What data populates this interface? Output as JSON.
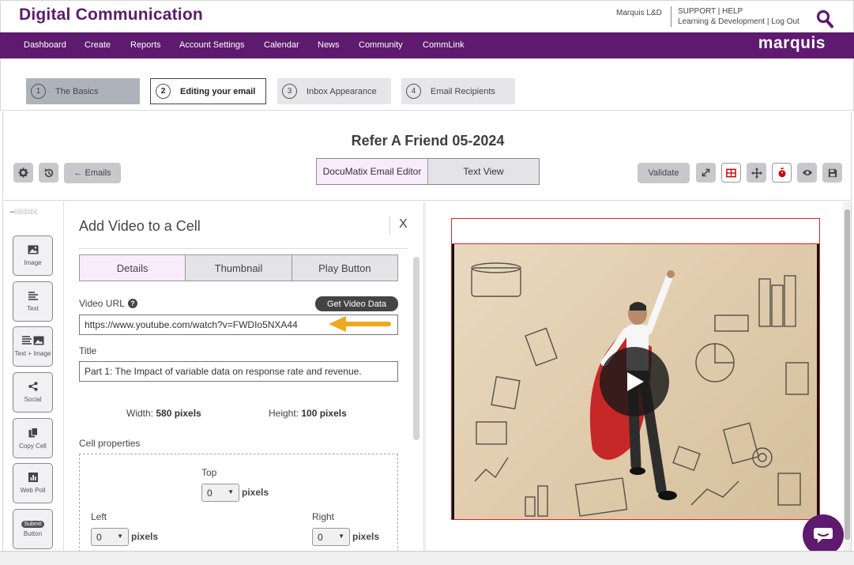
{
  "header": {
    "app_title": "Digital Communication",
    "user": "Marquis L&D",
    "support": "SUPPORT",
    "help": "HELP",
    "learning": "Learning & Development",
    "logout": "Log Out",
    "brand": "marquis"
  },
  "nav": {
    "items": [
      "Dashboard",
      "Create",
      "Reports",
      "Account Settings",
      "Calendar",
      "News",
      "Community",
      "CommLink"
    ]
  },
  "steps": [
    {
      "num": "1",
      "label": "The Basics"
    },
    {
      "num": "2",
      "label": "Editing your email"
    },
    {
      "num": "3",
      "label": "Inbox Appearance"
    },
    {
      "num": "4",
      "label": "Email Recipients"
    }
  ],
  "editor": {
    "email_title": "Refer A Friend 05-2024",
    "emails_button": "← Emails",
    "tab_editor": "DocuMatix Email Editor",
    "tab_text": "Text View",
    "validate": "Validate"
  },
  "rail": {
    "items": [
      "Image",
      "Text",
      "Text + Image",
      "Social",
      "Copy Cell",
      "Web Poll",
      "Button"
    ],
    "submit_pill": "Submit"
  },
  "panel": {
    "title": "Add Video to a Cell",
    "close": "X",
    "tabs": [
      "Details",
      "Thumbnail",
      "Play Button"
    ],
    "video_url_label": "Video URL",
    "help": "?",
    "get_video_data": "Get Video Data",
    "video_url": "https://www.youtube.com/watch?v=FWDIo5NXA44",
    "title_label": "Title",
    "title_value": "Part 1: The Impact of variable data on response rate and revenue.",
    "width_label": "Width:",
    "width_value": "580 pixels",
    "height_label": "Height:",
    "height_value": "100 pixels",
    "cell_props": "Cell properties",
    "top": "Top",
    "left": "Left",
    "right": "Right",
    "pad_value": "0",
    "pixels": "pixels"
  },
  "colors": {
    "brand_purple": "#5e1a6e",
    "active_tab": "#f9ebfb",
    "arrow": "#f0a820",
    "cell_border": "#dd2222"
  }
}
